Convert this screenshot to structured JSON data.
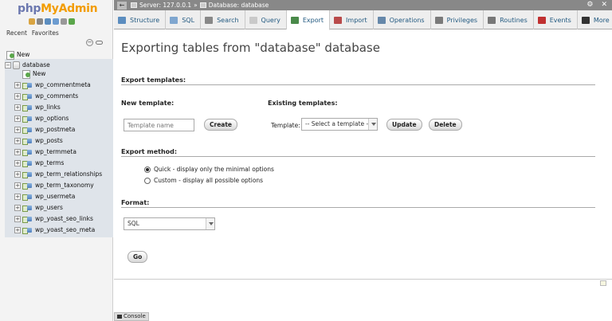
{
  "logo": {
    "php": "php",
    "my": "My",
    "admin": "Admin"
  },
  "sidebar": {
    "tabs": [
      "Recent",
      "Favorites"
    ],
    "collapse_icon": "minus-icon",
    "link_icon": "link-icon",
    "tree": {
      "new_label": "New",
      "database_label": "database",
      "db_new_label": "New",
      "tables": [
        "wp_commentmeta",
        "wp_comments",
        "wp_links",
        "wp_options",
        "wp_postmeta",
        "wp_posts",
        "wp_termmeta",
        "wp_terms",
        "wp_term_relationships",
        "wp_term_taxonomy",
        "wp_usermeta",
        "wp_users",
        "wp_yoast_seo_links",
        "wp_yoast_seo_meta"
      ]
    }
  },
  "topbar": {
    "server_label": "Server: 127.0.0.1",
    "separator": "»",
    "database_label": "Database: database",
    "settings_icon": "gear-icon",
    "close_icon": "close-icon"
  },
  "tabs": [
    {
      "label": "Structure",
      "icon": "structure-icon",
      "color": "#5b8dbf"
    },
    {
      "label": "SQL",
      "icon": "sql-icon",
      "color": "#7fa6cf"
    },
    {
      "label": "Search",
      "icon": "search-icon",
      "color": "#888888"
    },
    {
      "label": "Query",
      "icon": "query-icon",
      "color": "#c9c9c9"
    },
    {
      "label": "Export",
      "icon": "export-icon",
      "color": "#4a8a4a",
      "active": true
    },
    {
      "label": "Import",
      "icon": "import-icon",
      "color": "#b94a4a"
    },
    {
      "label": "Operations",
      "icon": "wrench-icon",
      "color": "#6688aa"
    },
    {
      "label": "Privileges",
      "icon": "privileges-icon",
      "color": "#7a7a7a"
    },
    {
      "label": "Routines",
      "icon": "routines-icon",
      "color": "#777777"
    },
    {
      "label": "Events",
      "icon": "clock-icon",
      "color": "#c03030"
    },
    {
      "label": "More",
      "icon": "caret-down-icon",
      "color": "#333333"
    }
  ],
  "main": {
    "title": "Exporting tables from \"database\" database",
    "export_templates_heading": "Export templates:",
    "new_template_label": "New template:",
    "template_name_placeholder": "Template name",
    "create_button": "Create",
    "existing_templates_label": "Existing templates:",
    "template_label": "Template:",
    "template_select_value": "-- Select a template --",
    "update_button": "Update",
    "delete_button": "Delete",
    "export_method_heading": "Export method:",
    "method_quick": "Quick - display only the minimal options",
    "method_custom": "Custom - display all possible options",
    "method_selected": "quick",
    "format_heading": "Format:",
    "format_value": "SQL",
    "go_button": "Go"
  },
  "console": {
    "label": "Console"
  },
  "colors": {
    "topbar_bg": "#888888",
    "link_color": "#235a81",
    "sidebar_bg": "#f3f3f3"
  }
}
